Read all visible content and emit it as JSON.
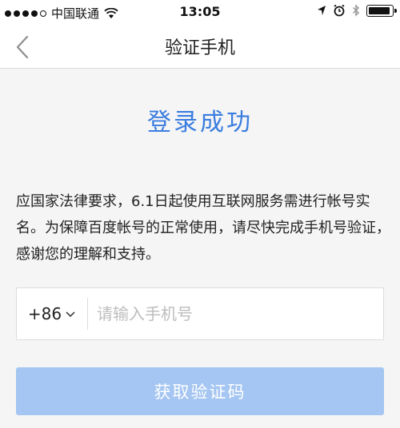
{
  "status_bar": {
    "carrier": "中国联通",
    "time": "13:05",
    "icons": [
      "signal-dots-icon",
      "wifi-icon",
      "location-arrow-icon",
      "alarm-icon",
      "bluetooth-icon",
      "battery-icon"
    ]
  },
  "nav": {
    "title": "验证手机",
    "back_icon": "chevron-left-icon"
  },
  "main": {
    "success_title": "登录成功",
    "notice": "应国家法律要求，6.1日起使用互联网服务需进行帐号实名。为保障百度帐号的正常使用，请尽快完成手机号验证，感谢您的理解和支持。",
    "country_code": "+86",
    "phone_placeholder": "请输入手机号",
    "phone_value": "",
    "get_code_label": "获取验证码"
  },
  "colors": {
    "accent": "#3a7de0",
    "button_disabled": "#a5c6f2",
    "background": "#f5f5f5"
  }
}
